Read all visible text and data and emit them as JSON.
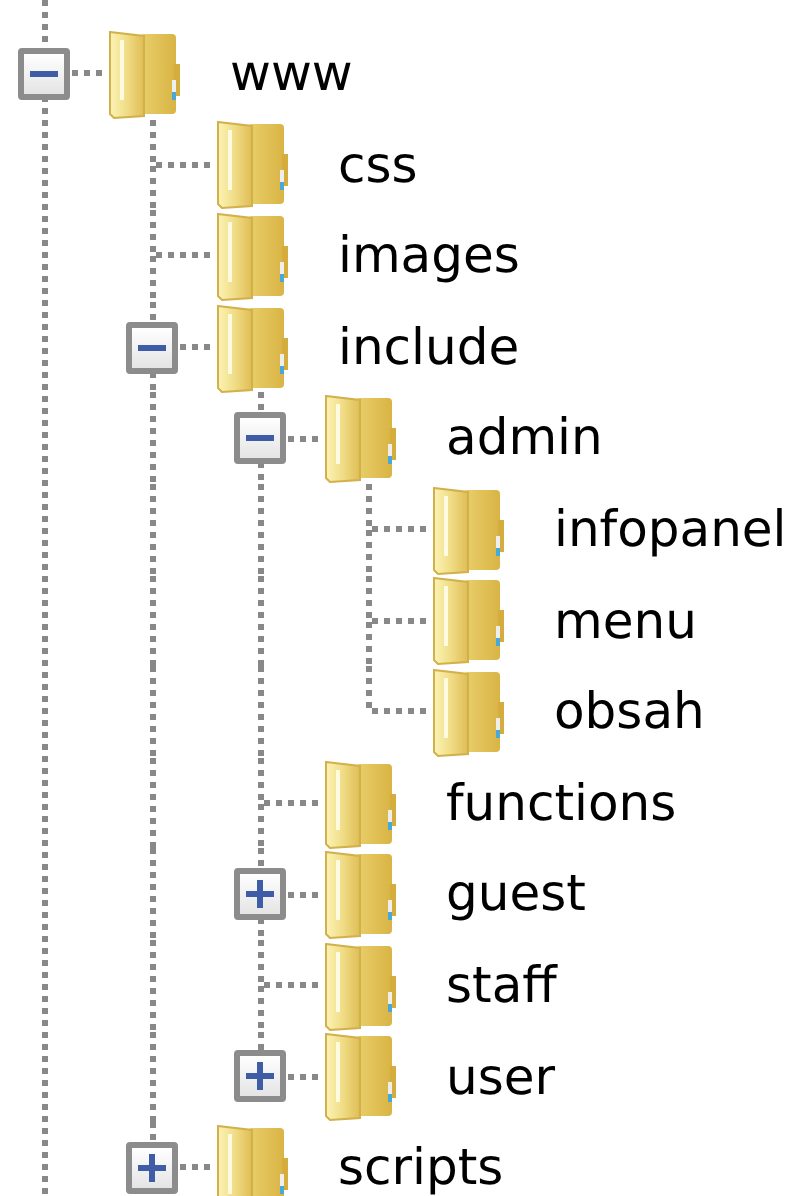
{
  "tree": [
    {
      "label": "www",
      "expanded": true,
      "children": [
        {
          "label": "css"
        },
        {
          "label": "images"
        },
        {
          "label": "include",
          "expanded": true,
          "children": [
            {
              "label": "admin",
              "expanded": true,
              "children": [
                {
                  "label": "infopanel"
                },
                {
                  "label": "menu"
                },
                {
                  "label": "obsah"
                }
              ]
            },
            {
              "label": "functions"
            },
            {
              "label": "guest",
              "expanded": false
            },
            {
              "label": "staff"
            },
            {
              "label": "user",
              "expanded": false
            }
          ]
        },
        {
          "label": "scripts",
          "expanded": false
        }
      ]
    }
  ]
}
